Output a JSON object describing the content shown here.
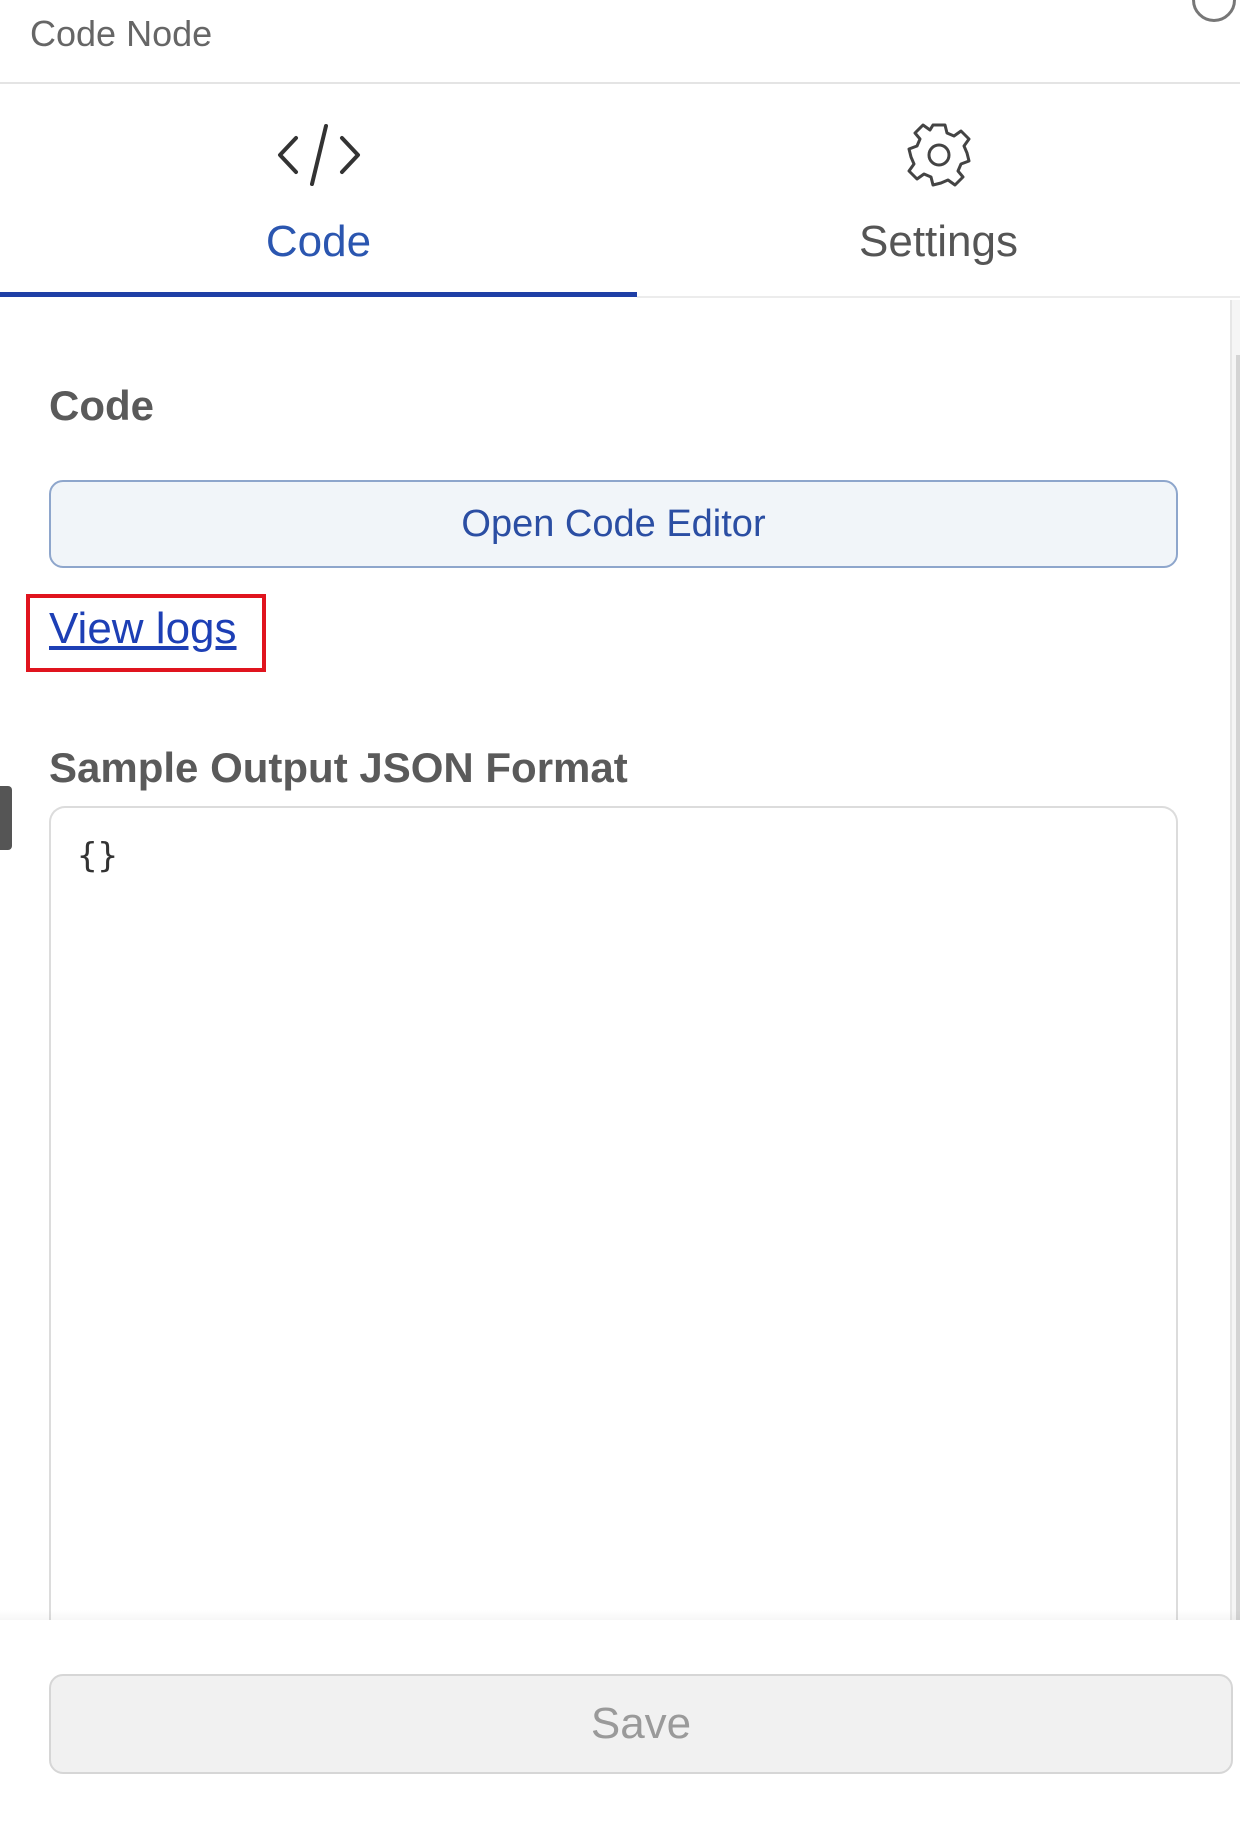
{
  "header": {
    "title": "Code Node"
  },
  "tabs": [
    {
      "label": "Code",
      "icon": "code-icon",
      "active": true
    },
    {
      "label": "Settings",
      "icon": "gear-icon",
      "active": false
    }
  ],
  "content": {
    "code_label": "Code",
    "open_editor_label": "Open Code Editor",
    "view_logs_label": "View logs",
    "sample_label": "Sample Output JSON Format",
    "sample_value": "{}"
  },
  "footer": {
    "save_label": "Save"
  },
  "colors": {
    "accent": "#1f3fa6",
    "link": "#1d3fb5",
    "highlight": "#e0141e"
  }
}
